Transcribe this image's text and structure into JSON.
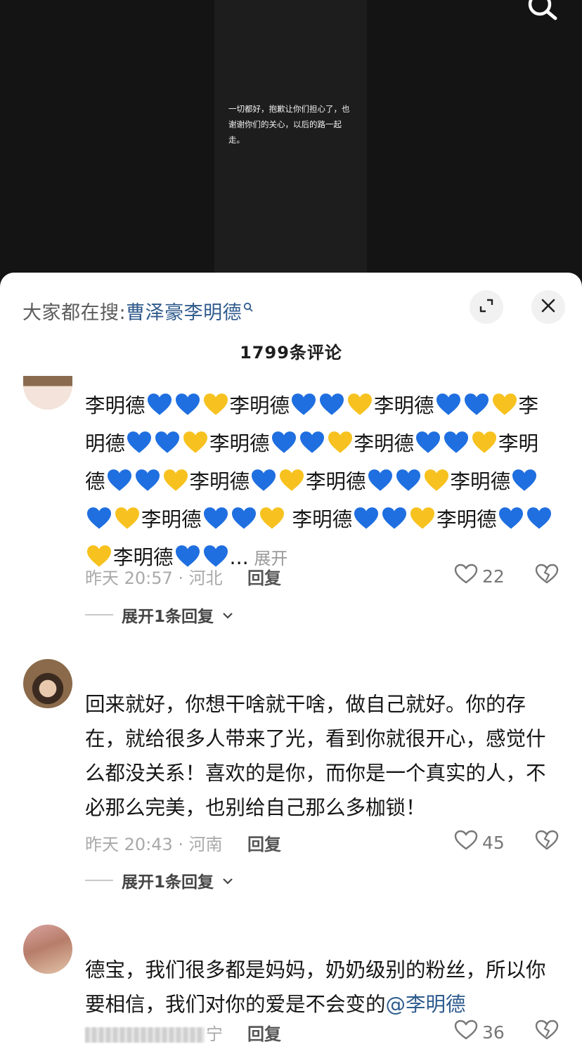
{
  "video": {
    "caption": "一切都好，抱歉让你们担心了，也谢谢你们的关心，以后的路一起走。"
  },
  "hot_search": {
    "prefix": "大家都在搜:",
    "keyword": "曹泽豪李明德"
  },
  "comments_header": {
    "count_label": "1799条评论"
  },
  "comments": [
    {
      "text_runs": [
        "李明德",
        "b",
        "b",
        "y",
        "李明德",
        "b",
        "b",
        "y",
        "李明德",
        "b",
        "b",
        "y",
        "李明德",
        "b",
        "b",
        "y",
        "李明德",
        "b",
        "b",
        "y",
        "李明德",
        "b",
        "b",
        "y",
        "李明德",
        "b",
        "b",
        "y",
        "李明德",
        "b",
        "y",
        "李明德",
        "b",
        "b",
        "y",
        "李明",
        "德",
        "b",
        "b",
        "y",
        "李明德",
        "b",
        "b",
        "y",
        " 李明德",
        "b",
        "b",
        "y",
        "李明",
        "德",
        "b",
        "b",
        "y",
        "李明德",
        "b",
        "b"
      ],
      "ellipsis": "...",
      "expand_label": "展开",
      "time_location": "昨天 20:57 · 河北",
      "reply_label": "回复",
      "likes": "22",
      "replies_toggle": "展开1条回复"
    },
    {
      "text": "回来就好，你想干啥就干啥，做自己就好。你的存在，就给很多人带来了光，看到你就很开心，感觉什么都没关系！喜欢的是你，而你是一个真实的人，不必那么完美，也别给自己那么多枷锁！",
      "time_location": "昨天 20:43 · 河南",
      "reply_label": "回复",
      "likes": "45",
      "replies_toggle": "展开1条回复"
    },
    {
      "text": "德宝，我们很多都是妈妈，奶奶级别的粉丝，所以你要相信，我们对你的爱是不会变的",
      "mention": "@李明德",
      "time_location_partial": "宁",
      "reply_label": "回复",
      "likes": "36"
    }
  ],
  "colors": {
    "blue_heart": "#1f6fe0",
    "yellow_heart": "#f7c21f",
    "link": "#2f5a8c",
    "sheet_bg": "#ffffff",
    "video_bg": "#141414"
  },
  "icons": [
    "search-icon",
    "expand-icon",
    "close-icon",
    "heart-outline-icon",
    "heart-broken-icon",
    "chevron-down-icon",
    "blue-heart-emoji",
    "yellow-heart-emoji"
  ]
}
